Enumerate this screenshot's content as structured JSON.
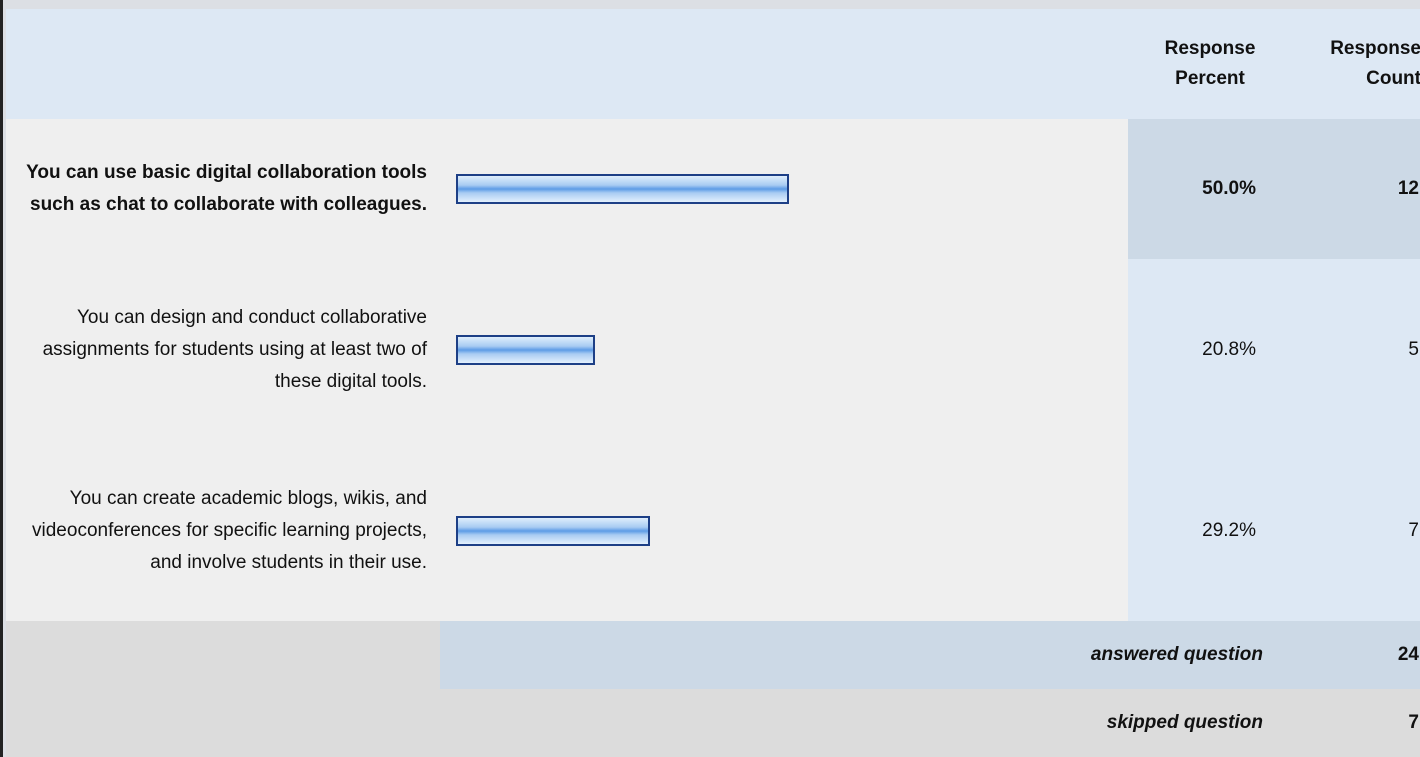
{
  "header": {
    "response_percent": "Response Percent",
    "response_count": "Response Count"
  },
  "chart_data": {
    "type": "bar",
    "orientation": "horizontal",
    "categories": [
      "You can use basic digital collaboration tools such as chat to collaborate with colleagues.",
      "You can design and conduct collaborative assignments for students using at least two of these digital tools.",
      "You can create academic blogs, wikis, and videoconferences for specific learning projects, and involve students in their use."
    ],
    "values": [
      50.0,
      20.8,
      29.2
    ],
    "percent_labels": [
      "50.0%",
      "20.8%",
      "29.2%"
    ],
    "counts": [
      "12",
      "5",
      "7"
    ],
    "highlighted_index": 0,
    "bar_color": "#5d9ce6",
    "bar_border_color": "#1d3f86"
  },
  "summary": {
    "answered_label": "answered question",
    "answered_value": "24",
    "skipped_label": "skipped question",
    "skipped_value": "7"
  }
}
